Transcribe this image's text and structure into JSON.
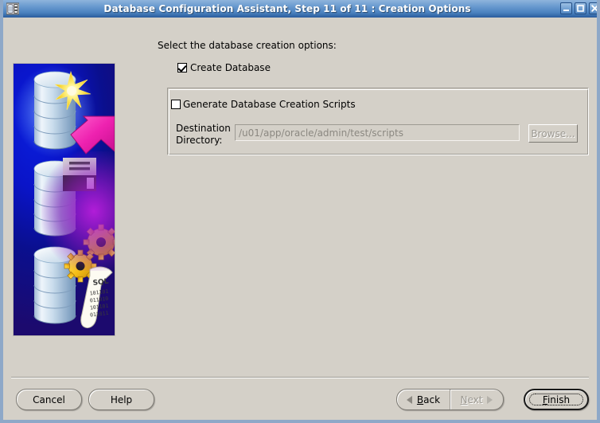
{
  "window": {
    "title": "Database Configuration Assistant, Step 11 of 11 : Creation Options",
    "icon": "database-app-icon",
    "controls": {
      "minimize": "_",
      "maximize": "□",
      "close": "✕"
    }
  },
  "main": {
    "instruction": "Select the database creation options:",
    "create_database": {
      "label": "Create Database",
      "checked": true
    },
    "scripts_group": {
      "label": "Generate Database Creation Scripts",
      "checked": false,
      "destination_label_line1": "Destination",
      "destination_label_line2": "Directory:",
      "destination_value": "/u01/app/oracle/admin/test/scripts",
      "browse_label": "Browse..."
    }
  },
  "side_image": {
    "alt": "oracle-database-creation-graphic",
    "sql_scroll_label": "SQL"
  },
  "footer": {
    "cancel_label": "Cancel",
    "help_label": "Help",
    "back_label": "Back",
    "back_mnemonic": "B",
    "next_label": "Next",
    "next_mnemonic": "N",
    "finish_label": "Finish",
    "finish_mnemonic": "F"
  },
  "colors": {
    "titlebar_blue": "#4b82bf",
    "window_face": "#d4d0c8",
    "field_disabled_text": "#8b8881",
    "graphic_blue": "#0a14c8",
    "graphic_purple": "#8a16c0",
    "arrow_magenta": "#ee22b0",
    "gear_gold": "#f5c518"
  }
}
